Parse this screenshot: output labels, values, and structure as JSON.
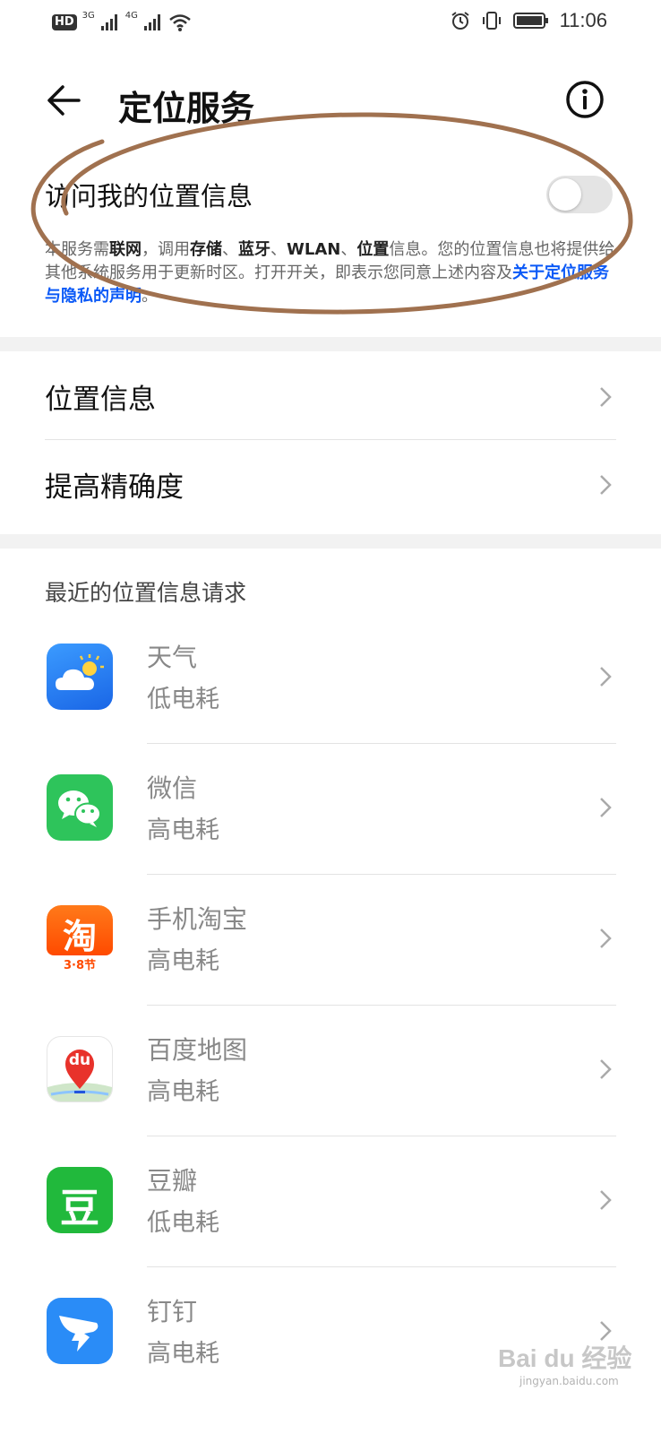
{
  "status_bar": {
    "hd_label": "HD",
    "net1": "3G",
    "net2": "4G",
    "time": "11:06"
  },
  "header": {
    "title": "定位服务"
  },
  "location_access": {
    "label": "访问我的位置信息",
    "enabled": false,
    "desc": {
      "p1": "本服务需",
      "b1": "联网",
      "p2": "，调用",
      "b2": "存储",
      "p3": "、",
      "b3": "蓝牙",
      "p4": "、",
      "b4": "WLAN",
      "p5": "、",
      "b5": "位置",
      "p6": "信息。您的位置信息也将提供给其他系统服务用于更新时区。打开开关，即表示您同意上述内容及",
      "link": "关于定位服务与隐私的声明",
      "p7": "。"
    }
  },
  "menu": [
    {
      "label": "位置信息"
    },
    {
      "label": "提高精确度"
    }
  ],
  "recent": {
    "title": "最近的位置信息请求",
    "apps": [
      {
        "name": "天气",
        "power": "低电耗",
        "icon": "weather-icon"
      },
      {
        "name": "微信",
        "power": "高电耗",
        "icon": "wechat-icon"
      },
      {
        "name": "手机淘宝",
        "power": "高电耗",
        "icon": "taobao-icon",
        "icon_text": "淘",
        "icon_sub": "3·8节"
      },
      {
        "name": "百度地图",
        "power": "高电耗",
        "icon": "baidu-map-icon",
        "icon_text": "du"
      },
      {
        "name": "豆瓣",
        "power": "低电耗",
        "icon": "douban-icon",
        "icon_text": "豆"
      },
      {
        "name": "钉钉",
        "power": "高电耗",
        "icon": "dingtalk-icon"
      }
    ]
  },
  "watermark": {
    "text": "Bai du 经验",
    "sub": "jingyan.baidu.com"
  },
  "colors": {
    "link": "#0a59f7",
    "annotation": "#a0714f",
    "background": "#f2f2f2"
  }
}
